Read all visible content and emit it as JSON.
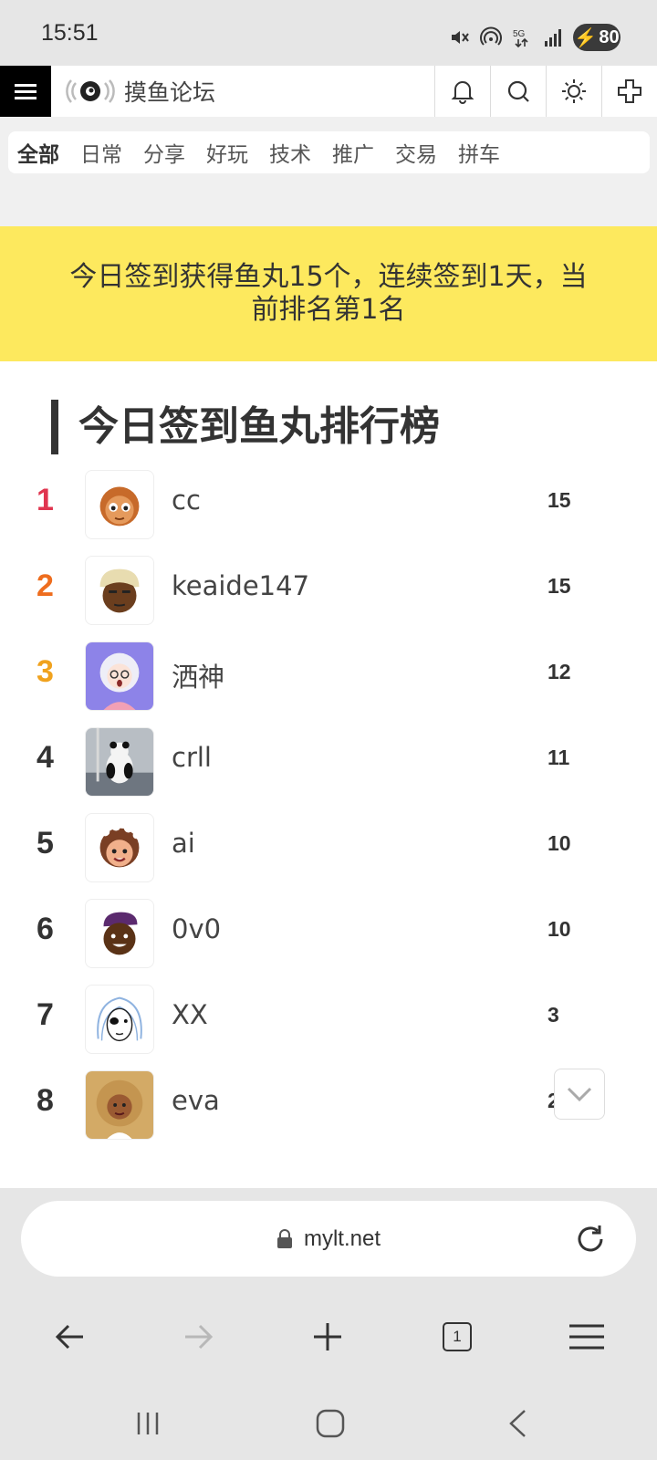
{
  "status_bar": {
    "time": "15:51",
    "battery": "80",
    "icons": [
      "mute-icon",
      "hotspot-icon",
      "5g-icon",
      "signal-icon",
      "battery-icon"
    ]
  },
  "header": {
    "site_title": "摸鱼论坛",
    "icons": [
      "menu-icon",
      "bell-icon",
      "search-icon",
      "theme-icon",
      "plus-icon"
    ]
  },
  "categories": [
    {
      "label": "全部",
      "active": true
    },
    {
      "label": "日常"
    },
    {
      "label": "分享"
    },
    {
      "label": "好玩"
    },
    {
      "label": "技术"
    },
    {
      "label": "推广"
    },
    {
      "label": "交易"
    },
    {
      "label": "拼车"
    }
  ],
  "banner": {
    "line1": "今日签到获得鱼丸15个，连续签到1天，当",
    "line2": "前排名第1名"
  },
  "leaderboard": {
    "title": "今日签到鱼丸排行榜",
    "entries": [
      {
        "rank": "1",
        "name": "cc",
        "score": "15",
        "rank_color": "#e0354f"
      },
      {
        "rank": "2",
        "name": "keaide147",
        "score": "15",
        "rank_color": "#ee6d1e"
      },
      {
        "rank": "3",
        "name": "洒神",
        "score": "12",
        "rank_color": "#f0a21e"
      },
      {
        "rank": "4",
        "name": "crll",
        "score": "11",
        "rank_color": "#333333"
      },
      {
        "rank": "5",
        "name": "ai",
        "score": "10",
        "rank_color": "#333333"
      },
      {
        "rank": "6",
        "name": "0v0",
        "score": "10",
        "rank_color": "#333333"
      },
      {
        "rank": "7",
        "name": "XX",
        "score": "3",
        "rank_color": "#333333"
      },
      {
        "rank": "8",
        "name": "eva",
        "score": "2",
        "rank_color": "#333333"
      }
    ]
  },
  "browser": {
    "url": "mylt.net",
    "tab_count": "1"
  }
}
